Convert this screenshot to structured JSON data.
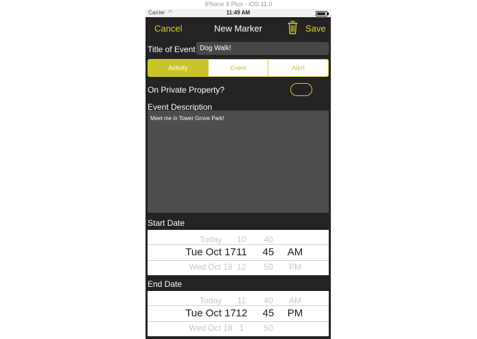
{
  "simulator": {
    "title": "iPhone 8 Plus - iOS 11.0"
  },
  "status_bar": {
    "carrier": "Carrier",
    "time": "11:49 AM"
  },
  "nav": {
    "cancel": "Cancel",
    "title": "New Marker",
    "trash_icon": "trash-icon",
    "save": "Save"
  },
  "colors": {
    "accent": "#d8d230",
    "background": "#242222",
    "field": "#4d4d4d"
  },
  "form": {
    "title_label": "Title of Event",
    "title_value": "Dog Walk!",
    "segments": [
      {
        "label": "Activity",
        "selected": true
      },
      {
        "label": "Event",
        "selected": false
      },
      {
        "label": "Alert",
        "selected": false
      }
    ],
    "private_label": "On Private Property?",
    "private_toggle": false,
    "description_label": "Event Description",
    "description_value": "Meet me in Tower Grove Park!"
  },
  "start_date": {
    "label": "Start Date",
    "above": [
      "Today",
      "10",
      "40",
      ""
    ],
    "selected": [
      "Tue Oct 17",
      "11",
      "45",
      "AM"
    ],
    "below": [
      "Wed Oct 18",
      "12",
      "50",
      "PM"
    ]
  },
  "end_date": {
    "label": "End Date",
    "above": [
      "Today",
      "11",
      "40",
      "AM"
    ],
    "selected": [
      "Tue Oct 17",
      "12",
      "45",
      "PM"
    ],
    "below": [
      "Wed Oct 18",
      "1",
      "50",
      ""
    ]
  }
}
